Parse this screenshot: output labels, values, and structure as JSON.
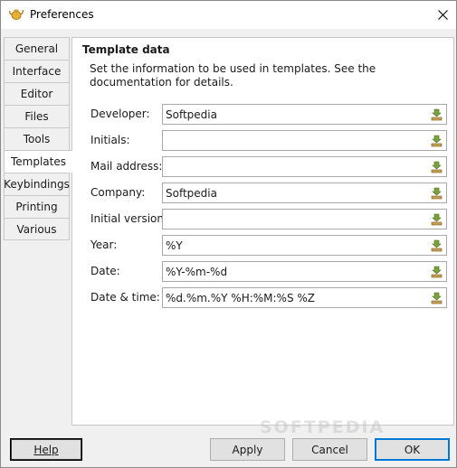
{
  "window": {
    "title": "Preferences",
    "close_glyph": "✕"
  },
  "tabs": [
    {
      "label": "General",
      "active": false
    },
    {
      "label": "Interface",
      "active": false
    },
    {
      "label": "Editor",
      "active": false
    },
    {
      "label": "Files",
      "active": false
    },
    {
      "label": "Tools",
      "active": false
    },
    {
      "label": "Templates",
      "active": true
    },
    {
      "label": "Keybindings",
      "active": false
    },
    {
      "label": "Printing",
      "active": false
    },
    {
      "label": "Various",
      "active": false
    }
  ],
  "panel": {
    "title": "Template data",
    "description": "Set the information to be used in templates. See the documentation for details."
  },
  "fields": [
    {
      "label": "Developer:",
      "value": "Softpedia"
    },
    {
      "label": "Initials:",
      "value": ""
    },
    {
      "label": "Mail address:",
      "value": ""
    },
    {
      "label": "Company:",
      "value": "Softpedia"
    },
    {
      "label": "Initial version:",
      "value": ""
    },
    {
      "label": "Year:",
      "value": "%Y"
    },
    {
      "label": "Date:",
      "value": "%Y-%m-%d"
    },
    {
      "label": "Date & time:",
      "value": "%d.%m.%Y %H:%M:%S %Z"
    }
  ],
  "buttons": {
    "help": "Help",
    "apply": "Apply",
    "cancel": "Cancel",
    "ok": "OK"
  },
  "watermark": "SOFTPEDIA",
  "icons": {
    "app": "geany-teapot-icon",
    "field_action": "insert-icon"
  },
  "colors": {
    "accent": "#0078d7",
    "insert_icon": "#7aa23a"
  }
}
